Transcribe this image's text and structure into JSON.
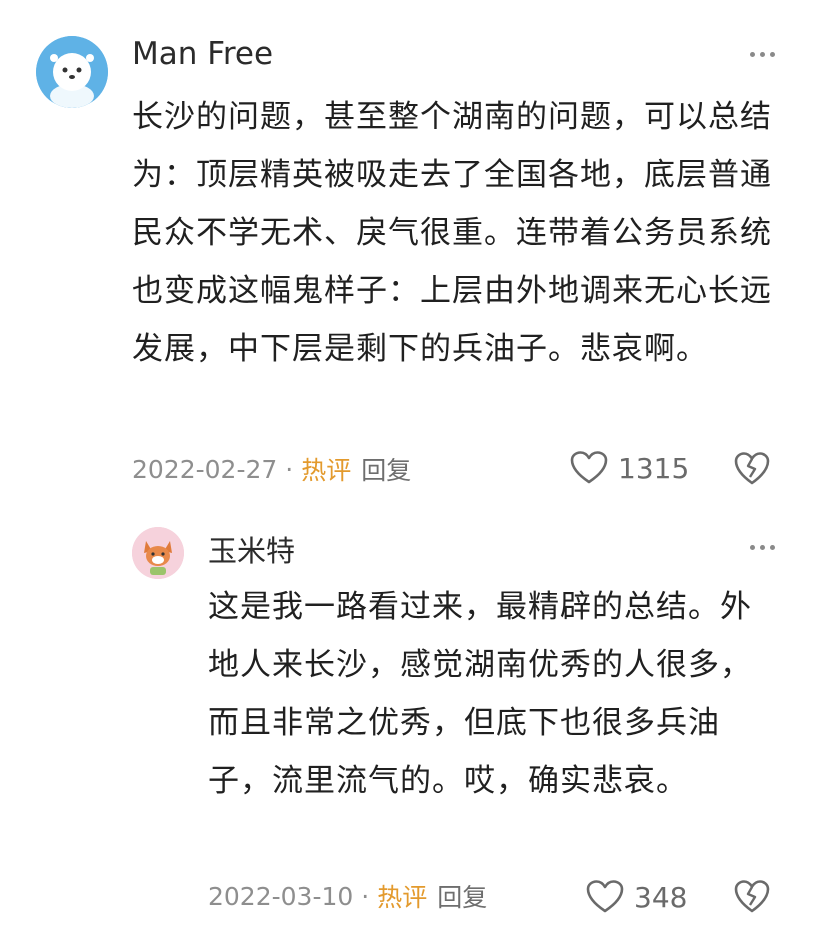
{
  "comments": [
    {
      "author": "Man Free",
      "text": "长沙的问题，甚至整个湖南的问题，可以总结为：顶层精英被吸走去了全国各地，底层普通民众不学无术、戾气很重。连带着公务员系统也变成这幅鬼样子：上层由外地调来无心长远发展，中下层是剩下的兵油子。悲哀啊。",
      "date": "2022-02-27",
      "separator": "·",
      "hot_label": "热评",
      "reply_label": "回复",
      "like_count": "1315"
    },
    {
      "author": "玉米特",
      "text": "这是我一路看过来，最精辟的总结。外地人来长沙，感觉湖南优秀的人很多，而且非常之优秀，但底下也很多兵油子，流里流气的。哎，确实悲哀。",
      "date": "2022-03-10",
      "separator": "·",
      "hot_label": "热评",
      "reply_label": "回复",
      "like_count": "348"
    }
  ],
  "colors": {
    "hot": "#e39a2d",
    "meta": "#8e8e8e",
    "text": "#202020"
  },
  "icons": [
    "more-icon",
    "heart-icon",
    "dislike-heart-icon"
  ]
}
